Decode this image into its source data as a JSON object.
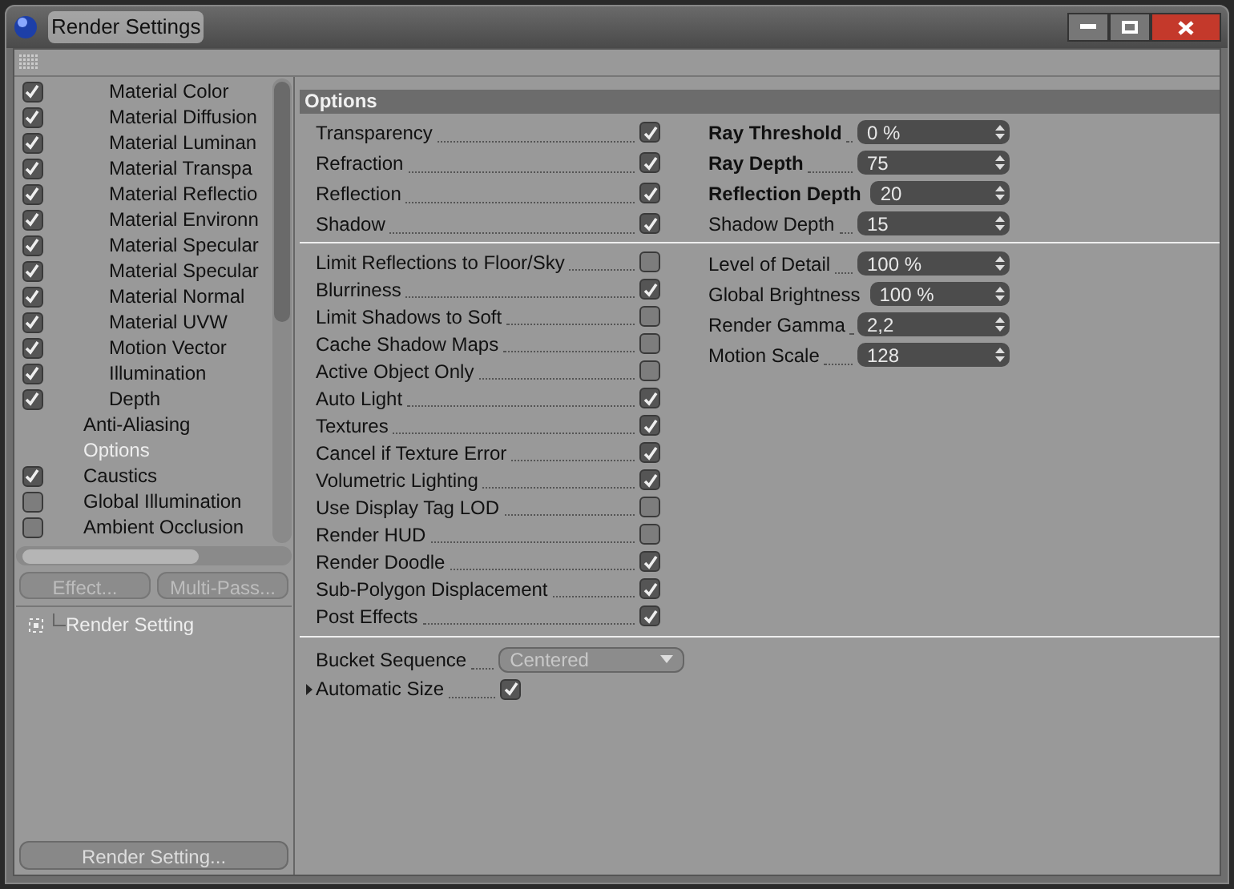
{
  "window": {
    "title": "Render Settings"
  },
  "tree": [
    {
      "children": [
        {
          "label": "Material Color",
          "kind": "check",
          "checked": true
        },
        {
          "label": "Material Diffusion",
          "kind": "check",
          "checked": true
        },
        {
          "label": "Material Luminan",
          "kind": "check",
          "checked": true
        },
        {
          "label": "Material Transpa",
          "kind": "check",
          "checked": true
        },
        {
          "label": "Material Reflectio",
          "kind": "check",
          "checked": true
        },
        {
          "label": "Material Environn",
          "kind": "check",
          "checked": true
        },
        {
          "label": "Material Specular",
          "kind": "check",
          "checked": true
        },
        {
          "label": "Material Specular",
          "kind": "check",
          "checked": true
        },
        {
          "label": "Material Normal",
          "kind": "check",
          "checked": true
        },
        {
          "label": "Material UVW",
          "kind": "check",
          "checked": true
        },
        {
          "label": "Motion Vector",
          "kind": "check",
          "checked": true
        },
        {
          "label": "Illumination",
          "kind": "check",
          "checked": true
        },
        {
          "label": "Depth",
          "kind": "check",
          "checked": true
        }
      ]
    },
    {
      "label": "Anti-Aliasing",
      "kind": "plain",
      "selected": false
    },
    {
      "label": "Options",
      "kind": "plain",
      "selected": true
    },
    {
      "label": "Caustics",
      "kind": "check",
      "checked": true
    },
    {
      "label": "Global Illumination",
      "kind": "check",
      "checked": false
    },
    {
      "label": "Ambient Occlusion",
      "kind": "check",
      "checked": false
    }
  ],
  "tree_buttons": [
    "Effect...",
    "Multi-Pass..."
  ],
  "settings_list": [
    {
      "label": "Render Setting"
    }
  ],
  "bottom_button": "Render Setting...",
  "options": {
    "title": "Options",
    "group1_left": [
      {
        "label": "Transparency",
        "checked": true
      },
      {
        "label": "Refraction",
        "checked": true
      },
      {
        "label": "Reflection",
        "checked": true
      },
      {
        "label": "Shadow",
        "checked": true
      }
    ],
    "group1_right": [
      {
        "label": "Ray Threshold",
        "bold": true,
        "value": "0 %"
      },
      {
        "label": "Ray Depth",
        "bold": true,
        "value": "75"
      },
      {
        "label": "Reflection Depth",
        "bold": true,
        "value": "20"
      },
      {
        "label": "Shadow Depth",
        "bold": false,
        "value": "15"
      }
    ],
    "group2_left": [
      {
        "label": "Limit Reflections to Floor/Sky",
        "checked": false
      },
      {
        "label": "Blurriness",
        "checked": true
      },
      {
        "label": "Limit Shadows to Soft",
        "checked": false
      },
      {
        "label": "Cache Shadow Maps",
        "checked": false
      },
      {
        "label": "Active Object Only",
        "checked": false
      },
      {
        "label": "Auto Light",
        "checked": true
      },
      {
        "label": "Textures",
        "checked": true
      },
      {
        "label": "Cancel if Texture Error",
        "checked": true
      },
      {
        "label": "Volumetric Lighting",
        "checked": true
      },
      {
        "label": "Use Display Tag LOD",
        "checked": false
      },
      {
        "label": "Render HUD",
        "checked": false
      },
      {
        "label": "Render Doodle",
        "checked": true
      },
      {
        "label": "Sub-Polygon Displacement",
        "checked": true
      },
      {
        "label": "Post Effects",
        "checked": true
      }
    ],
    "group2_right": [
      {
        "label": "Level of Detail",
        "bold": false,
        "value": "100 %"
      },
      {
        "label": "Global Brightness",
        "bold": false,
        "value": "100 %"
      },
      {
        "label": "Render Gamma",
        "bold": false,
        "value": "2,2"
      },
      {
        "label": "Motion Scale",
        "bold": false,
        "value": "128"
      }
    ],
    "bucket_sequence": {
      "label": "Bucket Sequence",
      "value": "Centered"
    },
    "automatic_size": {
      "label": "Automatic Size",
      "checked": true
    }
  }
}
